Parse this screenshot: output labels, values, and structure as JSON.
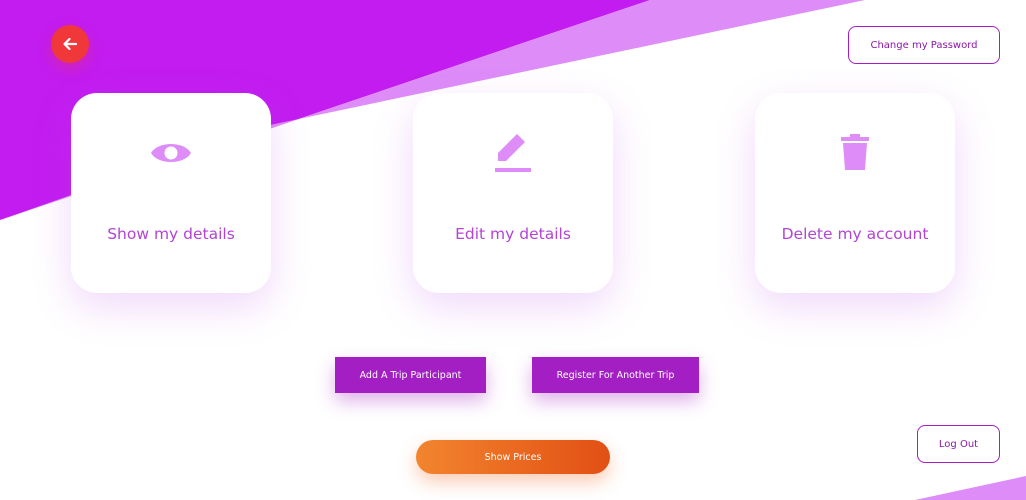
{
  "header": {
    "back_icon": "arrow-left-icon",
    "change_password_label": "Change my Password"
  },
  "cards": [
    {
      "icon": "eye-icon",
      "label": "Show my details"
    },
    {
      "icon": "pencil-icon",
      "label": "Edit my details"
    },
    {
      "icon": "trash-icon",
      "label": "Delete my account"
    }
  ],
  "actions": {
    "add_participant_label": "Add A Trip Participant",
    "register_trip_label": "Register For Another Trip",
    "show_prices_label": "Show Prices"
  },
  "footer": {
    "logout_label": "Log Out"
  },
  "colors": {
    "primary_purple": "#a31fc3",
    "light_purple": "#dd8cf8",
    "accent_red": "#f0373a",
    "orange_start": "#f2852e",
    "orange_end": "#e24f14"
  }
}
